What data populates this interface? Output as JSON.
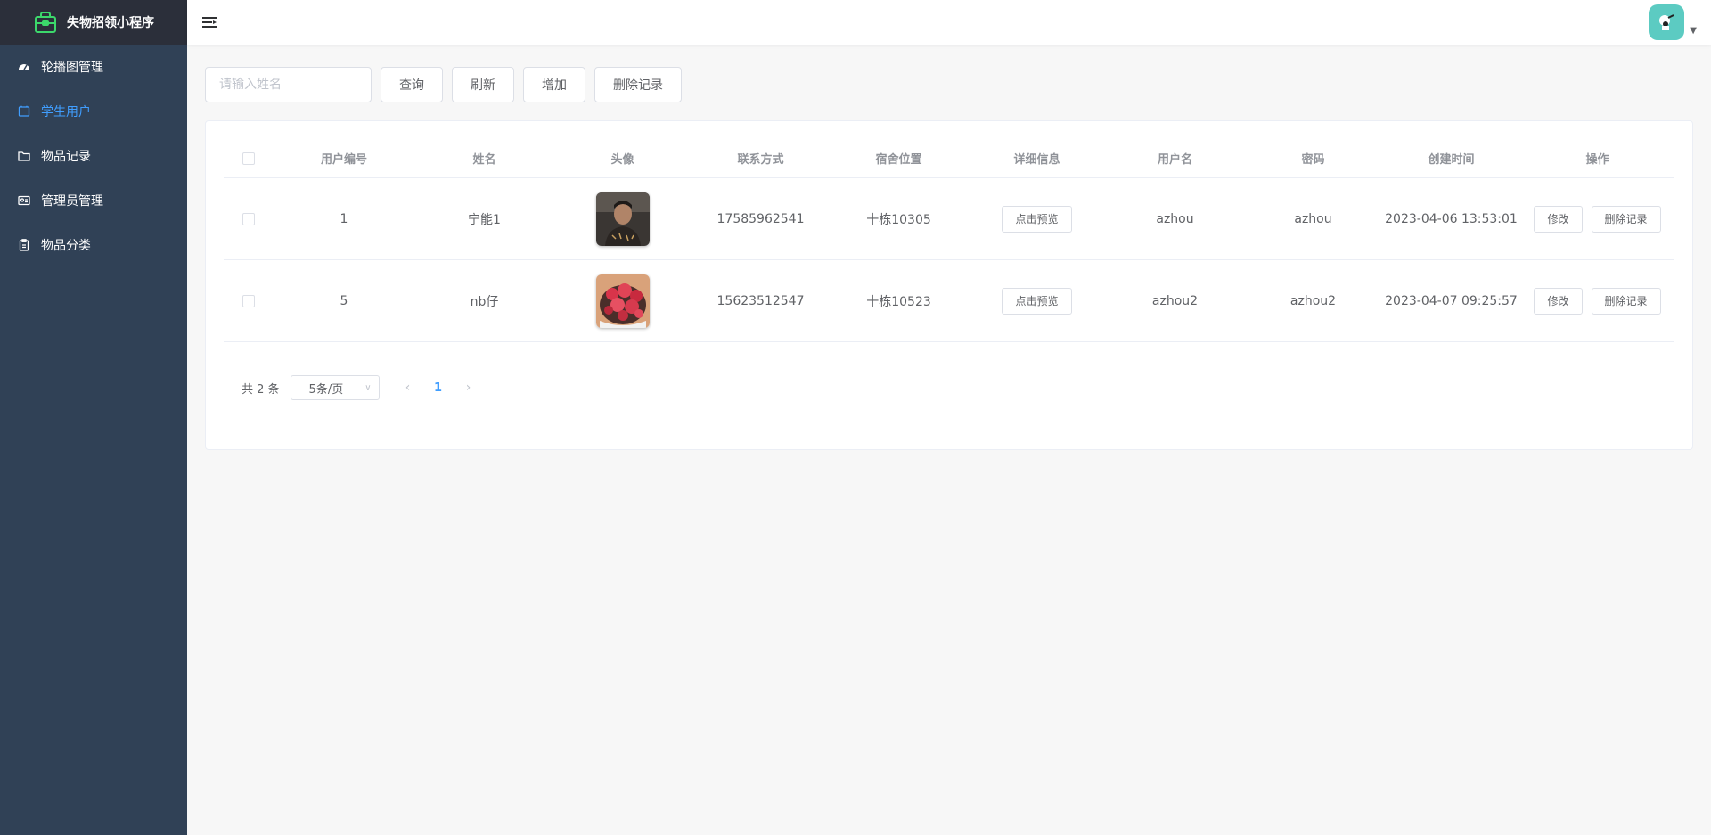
{
  "app": {
    "title": "失物招领小程序"
  },
  "sidebar": {
    "items": [
      {
        "label": "轮播图管理",
        "icon": "dashboard-icon",
        "active": false
      },
      {
        "label": "学生用户",
        "icon": "user-card-icon",
        "active": true
      },
      {
        "label": "物品记录",
        "icon": "folder-icon",
        "active": false
      },
      {
        "label": "管理员管理",
        "icon": "id-card-icon",
        "active": false
      },
      {
        "label": "物品分类",
        "icon": "clipboard-icon",
        "active": false
      }
    ]
  },
  "toolbar": {
    "search_placeholder": "请输入姓名",
    "search_value": "",
    "query_label": "查询",
    "refresh_label": "刷新",
    "add_label": "增加",
    "delete_label": "删除记录"
  },
  "table": {
    "headers": {
      "id": "用户编号",
      "name": "姓名",
      "avatar": "头像",
      "phone": "联系方式",
      "dorm": "宿舍位置",
      "detail": "详细信息",
      "username": "用户名",
      "password": "密码",
      "created": "创建时间",
      "ops": "操作"
    },
    "rows": [
      {
        "id": "1",
        "name": "宁能1",
        "phone": "17585962541",
        "dorm": "十栋10305",
        "detail_btn": "点击预览",
        "username": "azhou",
        "password": "azhou",
        "created": "2023-04-06 13:53:01",
        "edit_btn": "修改",
        "delete_btn": "删除记录"
      },
      {
        "id": "5",
        "name": "nb仔",
        "phone": "15623512547",
        "dorm": "十栋10523",
        "detail_btn": "点击预览",
        "username": "azhou2",
        "password": "azhou2",
        "created": "2023-04-07 09:25:57",
        "edit_btn": "修改",
        "delete_btn": "删除记录"
      }
    ]
  },
  "pagination": {
    "total_text": "共 2 条",
    "page_size": "5条/页",
    "current_page": "1"
  },
  "colors": {
    "sidebar_bg": "#304156",
    "logo_bg": "#2b2f3a",
    "accent": "#409eff",
    "avatar_bg": "#5ccbc2",
    "logo_icon": "#3cd86b"
  }
}
